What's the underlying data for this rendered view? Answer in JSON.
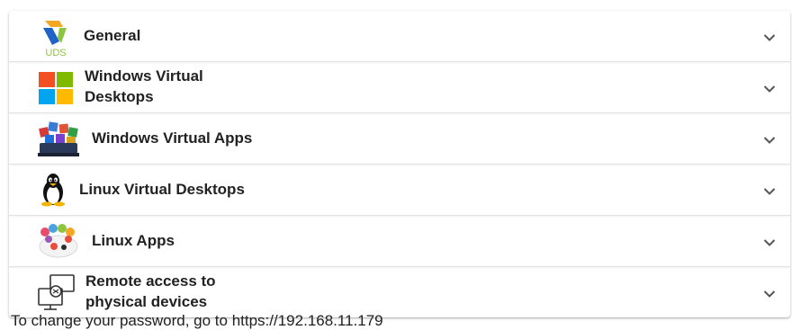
{
  "panels": [
    {
      "label": "General",
      "icon": "uds-logo-icon",
      "icon_text": "UDS"
    },
    {
      "label_line1": "Windows Virtual",
      "label_line2": "Desktops",
      "icon": "windows-logo-icon"
    },
    {
      "label": "Windows Virtual Apps",
      "icon": "windows-apps-icon"
    },
    {
      "label": "Linux Virtual Desktops",
      "icon": "linux-penguin-icon"
    },
    {
      "label": "Linux Apps",
      "icon": "linux-apps-icon"
    },
    {
      "label_line1": "Remote access to",
      "label_line2": "physical devices",
      "icon": "remote-desktop-icon"
    }
  ],
  "footer_text": "To change your password, go to https://192.168.11.179",
  "colors": {
    "windows_red": "#f25022",
    "windows_green": "#7fba00",
    "windows_blue": "#00a4ef",
    "windows_yellow": "#ffb900",
    "uds_orange": "#f5a623",
    "uds_green": "#8cc63f",
    "uds_blue": "#1f63c7"
  }
}
